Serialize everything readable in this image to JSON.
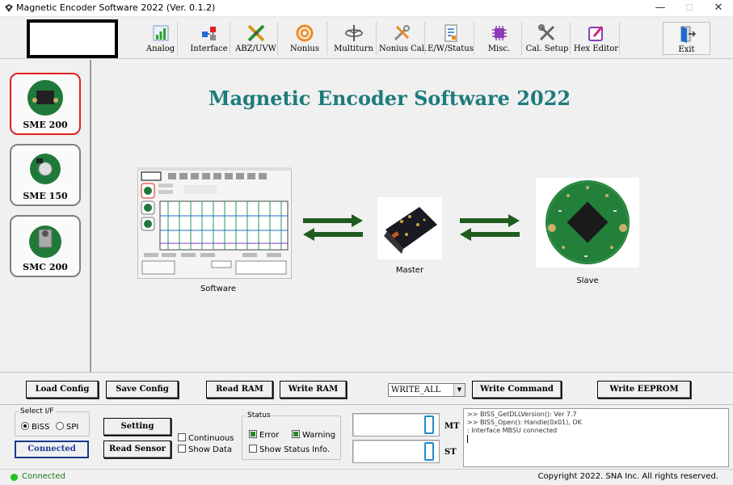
{
  "window": {
    "title": "Magnetic Encoder Software 2022 (Ver. 0.1.2)",
    "minimize": "—",
    "maximize": "☐",
    "close": "✕"
  },
  "toolbar": {
    "items": [
      {
        "label": "Analog",
        "icon": "analog-chart-icon"
      },
      {
        "label": "Interface",
        "icon": "interface-icon"
      },
      {
        "label": "ABZ/UVW",
        "icon": "abz-uvw-icon"
      },
      {
        "label": "Nonius",
        "icon": "nonius-icon"
      },
      {
        "label": "Multiturn",
        "icon": "multiturn-icon"
      },
      {
        "label": "Nonius Cal.",
        "icon": "nonius-cal-icon"
      },
      {
        "label": "E/W/Status",
        "icon": "error-warning-status-icon"
      },
      {
        "label": "Misc.",
        "icon": "misc-chip-icon"
      },
      {
        "label": "Cal. Setup",
        "icon": "tools-icon"
      },
      {
        "label": "Hex Editor",
        "icon": "hex-editor-icon"
      }
    ],
    "exit_label": "Exit"
  },
  "sidebar": {
    "devices": [
      {
        "label": "SME 200",
        "selected": true
      },
      {
        "label": "SME 150",
        "selected": false
      },
      {
        "label": "SMC 200",
        "selected": false
      }
    ]
  },
  "main": {
    "title": "Magnetic Encoder Software 2022",
    "software_caption": "Software",
    "master_caption": "Master",
    "slave_caption": "Slave"
  },
  "controls": {
    "load_config": "Load Config",
    "save_config": "Save Config",
    "read_ram": "Read RAM",
    "write_ram": "Write RAM",
    "write_select_value": "WRITE_ALL",
    "write_command": "Write Command",
    "write_eeprom": "Write EEPROM"
  },
  "interface": {
    "legend": "Select I/F",
    "biss_label": "BiSS",
    "spi_label": "SPI",
    "biss_selected": true,
    "connected_button": "Connected",
    "setting_button": "Setting",
    "read_sensor_button": "Read Sensor",
    "continuous_label": "Continuous",
    "show_data_label": "Show Data"
  },
  "status_group": {
    "legend": "Status",
    "error_label": "Error",
    "warning_label": "Warning",
    "show_status_label": "Show Status Info."
  },
  "readouts": {
    "mt_label": "MT",
    "st_label": "ST"
  },
  "log": {
    "lines": [
      ">> BISS_GetDLLVersion(): Ver 7.7",
      ">> BISS_Open(): Handle(0x01), OK",
      ": Interface MBSU connected"
    ]
  },
  "statusbar": {
    "status": "Connected",
    "copyright": "Copyright 2022. SNA Inc. All rights reserved."
  },
  "colors": {
    "title_teal": "#1e7b7b",
    "arrow_green": "#1f5c1f",
    "connected_green": "#22c322",
    "selected_red": "#e02020",
    "lcd_blue": "#1e8ccc"
  }
}
